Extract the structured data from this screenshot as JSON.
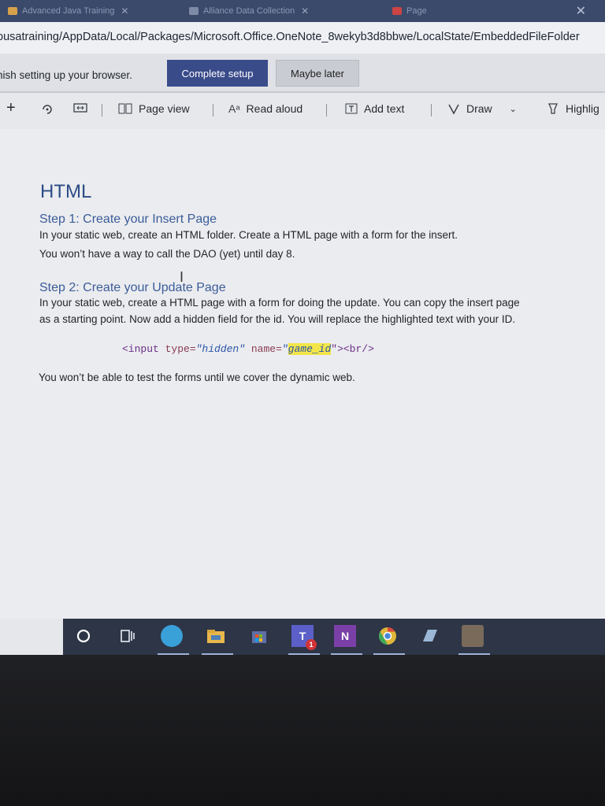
{
  "tabs": [
    {
      "label": "Advanced Java Training"
    },
    {
      "label": "Alliance Data Collection"
    },
    {
      "label": "Page"
    }
  ],
  "address": {
    "url": "ousatraining/AppData/Local/Packages/Microsoft.Office.OneNote_8wekyb3d8bbwe/LocalState/EmbeddedFileFolder"
  },
  "banner": {
    "text": "nish setting up your browser.",
    "complete_label": "Complete setup",
    "later_label": "Maybe later"
  },
  "toolbar": {
    "page_view": "Page view",
    "read_aloud": "Read aloud",
    "add_text": "Add text",
    "draw": "Draw",
    "highlight": "Highlig"
  },
  "document": {
    "title": "HTML",
    "step1_heading": "Step 1: Create your Insert Page",
    "step1_line1": "In your static web, create an HTML folder. Create a HTML page with a form for the insert.",
    "step1_line2": "You won’t have a way to call the DAO (yet) until day 8.",
    "step2_heading": "Step 2: Create your Update Page",
    "step2_line1": "In your static web, create a HTML page with a form for doing the update. You can copy the insert page",
    "step2_line2": "as a starting point. Now add a hidden field for the id. You will replace the highlighted text with your ID.",
    "code": {
      "open": "<input ",
      "type_attr": "type=",
      "type_val": "\"hidden\"",
      "name_attr": " name=",
      "quote_open": "\"",
      "highlight": "game_id",
      "close": "\"><br/>"
    },
    "footer": "You won’t be able to test the forms until we cover the dynamic web."
  },
  "taskbar": {
    "items": [
      "search-circle",
      "task-view",
      "edge",
      "file-explorer",
      "store",
      "teams",
      "onenote",
      "chrome",
      "app",
      "app2"
    ],
    "teams_badge": "1",
    "onenote_letter": "N",
    "teams_letter": "T"
  },
  "colors": {
    "accent": "#3a4b8a",
    "title": "#2c4c86",
    "highlight": "#f2e54a"
  }
}
